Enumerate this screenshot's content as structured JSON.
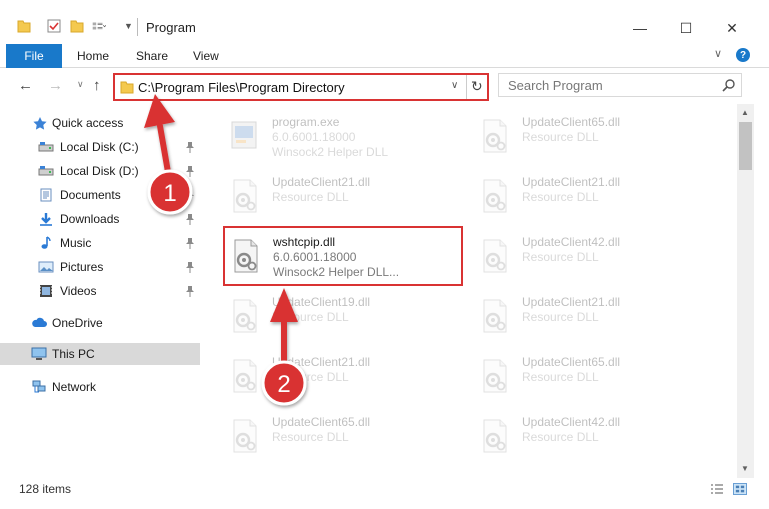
{
  "window": {
    "title": "Program",
    "minimize": "—",
    "maximize": "☐",
    "close": "✕"
  },
  "ribbon": {
    "tabs": [
      "File",
      "Home",
      "Share",
      "View"
    ]
  },
  "navigation": {
    "address": "C:\\Program Files\\Program Directory",
    "search_placeholder": "Search Program"
  },
  "sidebar": {
    "items": [
      {
        "label": "Quick access",
        "icon": "star-icon",
        "pinned": false
      },
      {
        "label": "Local Disk (C:)",
        "icon": "drive-icon",
        "pinned": true
      },
      {
        "label": "Local Disk (D:)",
        "icon": "drive-icon",
        "pinned": true
      },
      {
        "label": "Documents",
        "icon": "documents-icon",
        "pinned": true
      },
      {
        "label": "Downloads",
        "icon": "download-icon",
        "pinned": true
      },
      {
        "label": "Music",
        "icon": "music-icon",
        "pinned": true
      },
      {
        "label": "Pictures",
        "icon": "pictures-icon",
        "pinned": true
      },
      {
        "label": "Videos",
        "icon": "videos-icon",
        "pinned": true
      },
      {
        "label": "OneDrive",
        "icon": "cloud-icon",
        "pinned": false
      },
      {
        "label": "This PC",
        "icon": "computer-icon",
        "pinned": false,
        "selected": true
      },
      {
        "label": "Network",
        "icon": "network-icon",
        "pinned": false
      }
    ]
  },
  "files": [
    {
      "name": "program.exe",
      "version": "6.0.6001.18000",
      "description": "Winsock2 Helper DLL",
      "icon": "exe-icon",
      "faded": true
    },
    {
      "name": "UpdateClient65.dll",
      "description": "Resource DLL",
      "icon": "dll-icon",
      "faded": true
    },
    {
      "name": "UpdateClient21.dll",
      "description": "Resource DLL",
      "icon": "dll-icon",
      "faded": true
    },
    {
      "name": "UpdateClient21.dll",
      "description": "Resource DLL",
      "icon": "dll-icon",
      "faded": true
    },
    {
      "name": "wshtcpip.dll",
      "version": "6.0.6001.18000",
      "description": "Winsock2 Helper DLL...",
      "icon": "dll-gear-icon",
      "faded": false,
      "highlighted": true
    },
    {
      "name": "UpdateClient42.dll",
      "description": "Resource DLL",
      "icon": "dll-icon",
      "faded": true
    },
    {
      "name": "UpdateClient19.dll",
      "description": "Resource DLL",
      "icon": "dll-icon",
      "faded": true
    },
    {
      "name": "UpdateClient21.dll",
      "description": "Resource DLL",
      "icon": "dll-icon",
      "faded": true
    },
    {
      "name": "UpdateClient21.dll",
      "description": "Resource DLL",
      "icon": "dll-icon",
      "faded": true
    },
    {
      "name": "UpdateClient65.dll",
      "description": "Resource DLL",
      "icon": "dll-icon",
      "faded": true
    },
    {
      "name": "UpdateClient65.dll",
      "description": "Resource DLL",
      "icon": "dll-icon",
      "faded": true
    },
    {
      "name": "UpdateClient42.dll",
      "description": "Resource DLL",
      "icon": "dll-icon",
      "faded": true
    },
    {
      "name": "",
      "description": "",
      "icon": "dll-icon",
      "faded": true
    },
    {
      "name": "",
      "description": "",
      "icon": "dll-icon",
      "faded": true
    }
  ],
  "status": {
    "item_count": "128 items"
  },
  "annotations": [
    {
      "label": "1"
    },
    {
      "label": "2"
    }
  ],
  "colors": {
    "accent": "#1979ca",
    "highlight": "#d93333"
  }
}
